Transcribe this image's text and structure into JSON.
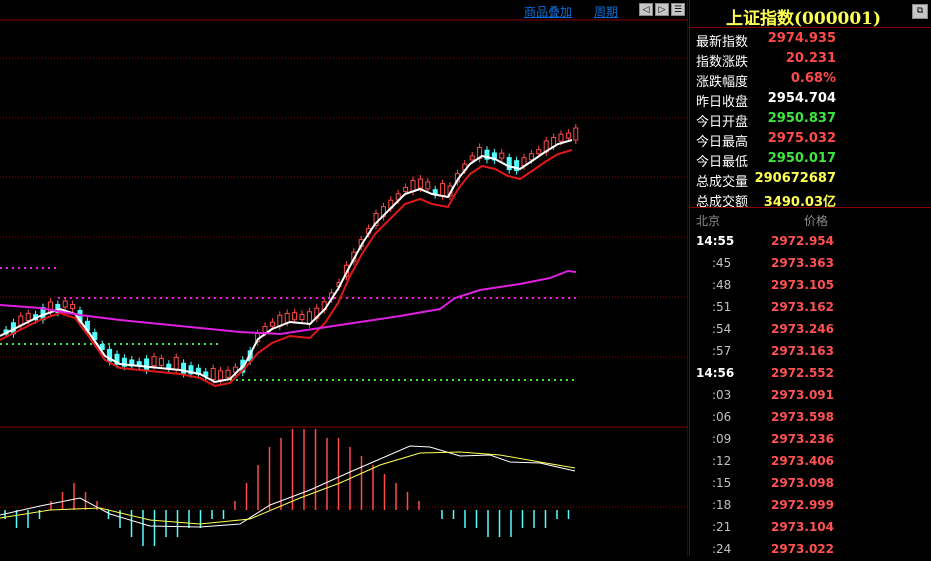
{
  "toolbar": {
    "overlay_label": "商品叠加",
    "period_label": "周期",
    "btn_left": "◁",
    "btn_right": "▷",
    "btn_menu": "☰"
  },
  "stats": {
    "title": "上证指数(000001)",
    "rows": [
      {
        "label": "最新指数",
        "value": "2974.935",
        "color": "#ff4a4a"
      },
      {
        "label": "指数涨跌",
        "value": "20.231",
        "color": "#ff4a4a"
      },
      {
        "label": "涨跌幅度",
        "value": "0.68%",
        "color": "#ff4a4a"
      },
      {
        "label": "昨日收盘",
        "value": "2954.704",
        "color": "#ffffff"
      },
      {
        "label": "今日开盘",
        "value": "2950.837",
        "color": "#3ee63e"
      },
      {
        "label": "今日最高",
        "value": "2975.032",
        "color": "#ff4a4a"
      },
      {
        "label": "今日最低",
        "value": "2950.017",
        "color": "#3ee63e"
      },
      {
        "label": "总成交量",
        "value": "290672687",
        "color": "#ffff54"
      },
      {
        "label": "总成交额",
        "value": "3490.03亿",
        "color": "#ffff54"
      }
    ]
  },
  "ticks": {
    "header_time": "北京",
    "header_price": "价格",
    "rows": [
      {
        "time": "14:55",
        "price": "2972.954",
        "bold": true
      },
      {
        "time": ":45",
        "price": "2973.363",
        "bold": false
      },
      {
        "time": ":48",
        "price": "2973.105",
        "bold": false
      },
      {
        "time": ":51",
        "price": "2973.162",
        "bold": false
      },
      {
        "time": ":54",
        "price": "2973.246",
        "bold": false
      },
      {
        "time": ":57",
        "price": "2973.163",
        "bold": false
      },
      {
        "time": "14:56",
        "price": "2972.552",
        "bold": true
      },
      {
        "time": ":03",
        "price": "2973.091",
        "bold": false
      },
      {
        "time": ":06",
        "price": "2973.598",
        "bold": false
      },
      {
        "time": ":09",
        "price": "2973.236",
        "bold": false
      },
      {
        "time": ":12",
        "price": "2973.406",
        "bold": false
      },
      {
        "time": ":15",
        "price": "2973.098",
        "bold": false
      },
      {
        "time": ":18",
        "price": "2972.999",
        "bold": false
      },
      {
        "time": ":21",
        "price": "2973.104",
        "bold": false
      },
      {
        "time": ":24",
        "price": "2973.022",
        "bold": false
      }
    ]
  },
  "colors": {
    "up": "#ff4a4a",
    "down": "#54ffff",
    "ma_short": "#ffffff",
    "ma_mid": "#e01818",
    "ma_long": "#e020e0",
    "grid": "#8b0000",
    "dif": "#ffffff",
    "dea": "#ffff54"
  },
  "chart_data": {
    "type": "candlestick",
    "up_close": [
      0,
      0,
      1,
      1,
      0,
      0,
      1,
      0,
      1,
      1,
      0,
      0,
      0,
      0,
      0,
      0,
      0,
      0,
      0,
      0,
      1,
      1,
      0,
      1,
      0,
      0,
      0,
      0,
      1,
      1,
      1,
      1,
      0,
      0,
      1,
      1,
      1,
      1,
      1,
      1,
      1,
      1,
      1,
      1,
      1,
      1,
      1,
      1,
      1,
      1,
      1,
      1,
      1,
      1,
      1,
      1,
      1,
      1,
      0,
      1,
      1,
      1,
      1,
      1,
      1,
      0,
      0,
      1,
      0,
      0,
      1,
      1,
      1,
      1,
      1,
      1,
      1,
      1
    ],
    "macd_hist": [
      -1,
      -2,
      -2,
      -1,
      1,
      2,
      3,
      2,
      1,
      -1,
      -2,
      -3,
      -4,
      -4,
      -3,
      -3,
      -2,
      -2,
      -1,
      -1,
      1,
      3,
      5,
      7,
      8,
      9,
      9,
      9,
      8,
      8,
      7,
      6,
      5,
      4,
      3,
      2,
      1,
      0,
      -1,
      -1,
      -2,
      -2,
      -3,
      -3,
      -3,
      -2,
      -2,
      -2,
      -1,
      -1
    ]
  }
}
